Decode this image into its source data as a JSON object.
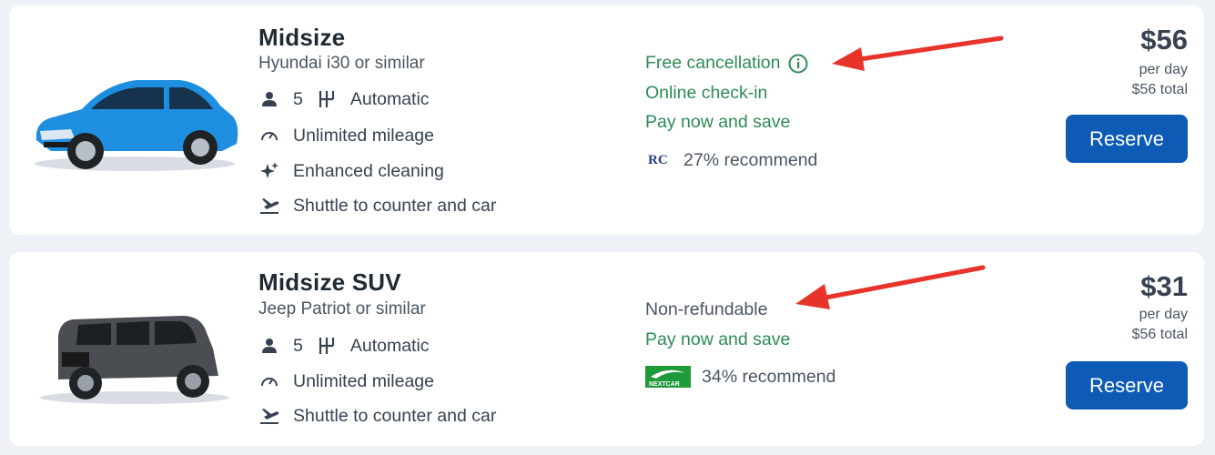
{
  "listings": [
    {
      "title": "Midsize",
      "subtitle": "Hyundai i30 or similar",
      "passengers": "5",
      "transmission": "Automatic",
      "mileage": "Unlimited mileage",
      "cleaning": "Enhanced cleaning",
      "shuttle": "Shuttle to counter and car",
      "policies": [
        "Free cancellation",
        "Online check-in",
        "Pay now and save"
      ],
      "recommend": "27% recommend",
      "vendor_logo": "RC",
      "price": "$56",
      "per_day": "per day",
      "total": "$56 total",
      "reserve_label": "Reserve",
      "car_color": "#1e8fe0"
    },
    {
      "title": "Midsize SUV",
      "subtitle": "Jeep Patriot or similar",
      "passengers": "5",
      "transmission": "Automatic",
      "mileage": "Unlimited mileage",
      "shuttle": "Shuttle to counter and car",
      "policies": [
        "Non-refundable",
        "Pay now and save"
      ],
      "recommend": "34% recommend",
      "vendor_logo": "NEXTCAR",
      "price": "$31",
      "per_day": "per day",
      "total": "$56 total",
      "reserve_label": "Reserve",
      "car_color": "#4a4d52"
    }
  ],
  "colors": {
    "accent": "#0d5bb5",
    "green": "#2e8b57",
    "annotation": "#e8332a"
  }
}
